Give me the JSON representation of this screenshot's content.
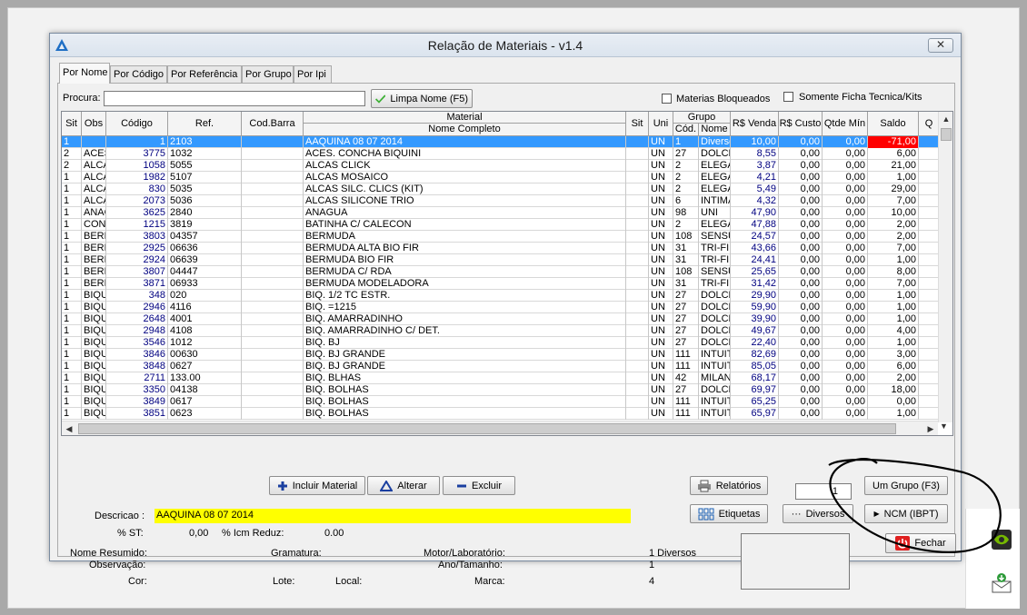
{
  "window": {
    "title": "Relação de Materiais - v1.4",
    "close_label": "✕"
  },
  "tabs": [
    {
      "label": "Por Nome"
    },
    {
      "label": "Por Código"
    },
    {
      "label": "Por Referência"
    },
    {
      "label": "Por Grupo"
    },
    {
      "label": "Por Ipi"
    }
  ],
  "search": {
    "label": "Procura:",
    "value": "",
    "clear_button": "Limpa Nome (F5)"
  },
  "filters": {
    "blocked_label": "Materias Bloqueados",
    "only_kits_label": "Somente Ficha Tecnica/Kits"
  },
  "grid": {
    "headers": {
      "sit": "Sit",
      "obs": "Obs",
      "codigo": "Código",
      "ref": "Ref.",
      "cod_barra": "Cod.Barra",
      "material": "Material",
      "nome_completo": "Nome Completo",
      "sit2": "Sit",
      "uni": "Uni",
      "grupo": "Grupo",
      "grupo_cod": "Cód.",
      "grupo_nome": "Nome",
      "venda": "R$ Venda",
      "custo": "R$ Custo",
      "qtde_min": "Qtde Mín",
      "saldo": "Saldo",
      "q": "Q"
    },
    "rows": [
      {
        "sit": "1",
        "obs": "",
        "codigo": "1",
        "ref": "2103",
        "material": "AAQUINA 08 07 2014",
        "uni": "UN",
        "gcod": "1",
        "gnome": "Diversos",
        "venda": "10,00",
        "custo": "0,00",
        "qmin": "0,00",
        "saldo": "-71,00"
      },
      {
        "sit": "2",
        "obs": "ACESSÓRIOS",
        "codigo": "3775",
        "ref": "1032",
        "material": "ACES. CONCHA BIQUINI",
        "uni": "UN",
        "gcod": "27",
        "gnome": "DOLCE",
        "venda": "8,55",
        "custo": "0,00",
        "qmin": "0,00",
        "saldo": "6,00"
      },
      {
        "sit": "2",
        "obs": "ALCAS",
        "codigo": "1058",
        "ref": "5055",
        "material": "ALCAS CLICK",
        "uni": "UN",
        "gcod": "2",
        "gnome": "ELEGANCE",
        "venda": "3,87",
        "custo": "0,00",
        "qmin": "0,00",
        "saldo": "21,00"
      },
      {
        "sit": "1",
        "obs": "ALCAS",
        "codigo": "1982",
        "ref": "5107",
        "material": "ALCAS MOSAICO",
        "uni": "UN",
        "gcod": "2",
        "gnome": "ELEGANCE",
        "venda": "4,21",
        "custo": "0,00",
        "qmin": "0,00",
        "saldo": "1,00"
      },
      {
        "sit": "1",
        "obs": "ALCAS",
        "codigo": "830",
        "ref": "5035",
        "material": "ALCAS SILC. CLICS (KIT)",
        "uni": "UN",
        "gcod": "2",
        "gnome": "ELEGANCE",
        "venda": "5,49",
        "custo": "0,00",
        "qmin": "0,00",
        "saldo": "29,00"
      },
      {
        "sit": "1",
        "obs": "ALCAS",
        "codigo": "2073",
        "ref": "5036",
        "material": "ALCAS SILICONE TRIO",
        "uni": "UN",
        "gcod": "6",
        "gnome": "INTIMA",
        "venda": "4,32",
        "custo": "0,00",
        "qmin": "0,00",
        "saldo": "7,00"
      },
      {
        "sit": "1",
        "obs": "ANAGUA",
        "codigo": "3625",
        "ref": "2840",
        "material": "ANAGUA",
        "uni": "UN",
        "gcod": "98",
        "gnome": "UNI",
        "venda": "47,90",
        "custo": "0,00",
        "qmin": "0,00",
        "saldo": "10,00"
      },
      {
        "sit": "1",
        "obs": "CONJUNTO",
        "codigo": "1215",
        "ref": "3819",
        "material": "BATINHA C/ CALECON",
        "uni": "UN",
        "gcod": "2",
        "gnome": "ELEGANCE",
        "venda": "47,88",
        "custo": "0,00",
        "qmin": "0,00",
        "saldo": "2,00"
      },
      {
        "sit": "1",
        "obs": "BERMUDA",
        "codigo": "3803",
        "ref": "04357",
        "material": "BERMUDA",
        "uni": "UN",
        "gcod": "108",
        "gnome": "SENSUAL",
        "venda": "24,57",
        "custo": "0,00",
        "qmin": "0,00",
        "saldo": "2,00"
      },
      {
        "sit": "1",
        "obs": "BERMUDA",
        "codigo": "2925",
        "ref": "06636",
        "material": "BERMUDA ALTA BIO FIR",
        "uni": "UN",
        "gcod": "31",
        "gnome": "TRI-FIL",
        "venda": "43,66",
        "custo": "0,00",
        "qmin": "0,00",
        "saldo": "7,00"
      },
      {
        "sit": "1",
        "obs": "BERMUDA",
        "codigo": "2924",
        "ref": "06639",
        "material": "BERMUDA BIO FIR",
        "uni": "UN",
        "gcod": "31",
        "gnome": "TRI-FIL",
        "venda": "24,41",
        "custo": "0,00",
        "qmin": "0,00",
        "saldo": "1,00"
      },
      {
        "sit": "1",
        "obs": "BERMUDA",
        "codigo": "3807",
        "ref": "04447",
        "material": "BERMUDA C/ RDA",
        "uni": "UN",
        "gcod": "108",
        "gnome": "SENSUAL",
        "venda": "25,65",
        "custo": "0,00",
        "qmin": "0,00",
        "saldo": "8,00"
      },
      {
        "sit": "1",
        "obs": "BERMUDA",
        "codigo": "3871",
        "ref": "06933",
        "material": "BERMUDA MODELADORA",
        "uni": "UN",
        "gcod": "31",
        "gnome": "TRI-FIL",
        "venda": "31,42",
        "custo": "0,00",
        "qmin": "0,00",
        "saldo": "7,00"
      },
      {
        "sit": "1",
        "obs": "BIQUINI",
        "codigo": "348",
        "ref": "020",
        "material": "BIQ. 1/2 TC ESTR.",
        "uni": "UN",
        "gcod": "27",
        "gnome": "DOLCE",
        "venda": "29,90",
        "custo": "0,00",
        "qmin": "0,00",
        "saldo": "1,00"
      },
      {
        "sit": "1",
        "obs": "BIQUINI",
        "codigo": "2946",
        "ref": "4116",
        "material": "BIQ. =1215",
        "uni": "UN",
        "gcod": "27",
        "gnome": "DOLCE",
        "venda": "59,90",
        "custo": "0,00",
        "qmin": "0,00",
        "saldo": "1,00"
      },
      {
        "sit": "1",
        "obs": "BIQUINI",
        "codigo": "2648",
        "ref": "4001",
        "material": "BIQ. AMARRADINHO",
        "uni": "UN",
        "gcod": "27",
        "gnome": "DOLCE",
        "venda": "39,90",
        "custo": "0,00",
        "qmin": "0,00",
        "saldo": "1,00"
      },
      {
        "sit": "1",
        "obs": "BIQUINI",
        "codigo": "2948",
        "ref": "4108",
        "material": "BIQ. AMARRADINHO C/ DET.",
        "uni": "UN",
        "gcod": "27",
        "gnome": "DOLCE",
        "venda": "49,67",
        "custo": "0,00",
        "qmin": "0,00",
        "saldo": "4,00"
      },
      {
        "sit": "1",
        "obs": "BIQUINI",
        "codigo": "3546",
        "ref": "1012",
        "material": "BIQ. BJ",
        "uni": "UN",
        "gcod": "27",
        "gnome": "DOLCE",
        "venda": "22,40",
        "custo": "0,00",
        "qmin": "0,00",
        "saldo": "1,00"
      },
      {
        "sit": "1",
        "obs": "BIQUINI",
        "codigo": "3846",
        "ref": "00630",
        "material": "BIQ. BJ GRANDE",
        "uni": "UN",
        "gcod": "111",
        "gnome": "INTUITIVA",
        "venda": "82,69",
        "custo": "0,00",
        "qmin": "0,00",
        "saldo": "3,00"
      },
      {
        "sit": "1",
        "obs": "BIQUINI",
        "codigo": "3848",
        "ref": "0627",
        "material": "BIQ. BJ GRANDE",
        "uni": "UN",
        "gcod": "111",
        "gnome": "INTUITIVA",
        "venda": "85,05",
        "custo": "0,00",
        "qmin": "0,00",
        "saldo": "6,00"
      },
      {
        "sit": "1",
        "obs": "BIQUINI",
        "codigo": "2711",
        "ref": "133.00",
        "material": "BIQ. BLHAS",
        "uni": "UN",
        "gcod": "42",
        "gnome": "MILANO",
        "venda": "68,17",
        "custo": "0,00",
        "qmin": "0,00",
        "saldo": "2,00"
      },
      {
        "sit": "1",
        "obs": "BIQUINI",
        "codigo": "3350",
        "ref": "04138",
        "material": "BIQ. BOLHAS",
        "uni": "UN",
        "gcod": "27",
        "gnome": "DOLCE",
        "venda": "69,97",
        "custo": "0,00",
        "qmin": "0,00",
        "saldo": "18,00"
      },
      {
        "sit": "1",
        "obs": "BIQUINI",
        "codigo": "3849",
        "ref": "0617",
        "material": "BIQ. BOLHAS",
        "uni": "UN",
        "gcod": "111",
        "gnome": "INTUITIVA",
        "venda": "65,25",
        "custo": "0,00",
        "qmin": "0,00",
        "saldo": "0,00"
      },
      {
        "sit": "1",
        "obs": "BIQUINI",
        "codigo": "3851",
        "ref": "0623",
        "material": "BIQ. BOLHAS",
        "uni": "UN",
        "gcod": "111",
        "gnome": "INTUITIVA",
        "venda": "65,97",
        "custo": "0,00",
        "qmin": "0,00",
        "saldo": "1,00"
      }
    ]
  },
  "actions": {
    "incluir": "Incluir Material",
    "alterar": "Alterar",
    "excluir": "Excluir",
    "relatorios": "Relatórios",
    "um_grupo": "Um Grupo (F3)",
    "etiquetas": "Etiquetas",
    "diversos": "Diversos",
    "ncm": "NCM (IBPT)",
    "fechar": "Fechar",
    "spin_value": "1"
  },
  "details": {
    "descricao_label": "Descricao :",
    "descricao_value": "AAQUINA 08 07 2014",
    "st_label": "% ST:",
    "st_value": "0,00",
    "icm_label": "% Icm Reduz:",
    "icm_value": "0.00",
    "nome_resumido_label": "Nome Resumido:",
    "observacao_label": "Observação:",
    "cor_label": "Cor:",
    "gramatura_label": "Gramatura:",
    "lote_label": "Lote:",
    "local_label": "Local:",
    "motor_label": "Motor/Laboratório:",
    "ano_label": "Ano/Tamanho:",
    "marca_label": "Marca:",
    "motor_value": "1  Diversos",
    "ano_value": "1",
    "marca_value": "4"
  }
}
